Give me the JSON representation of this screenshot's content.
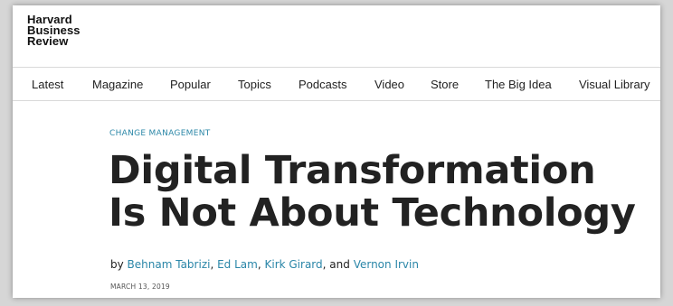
{
  "logo": {
    "line1": "Harvard",
    "line2": "Business",
    "line3": "Review"
  },
  "nav": {
    "items": [
      "Latest",
      "Magazine",
      "Popular",
      "Topics",
      "Podcasts",
      "Video",
      "Store",
      "The Big Idea",
      "Visual Library"
    ]
  },
  "article": {
    "category": "CHANGE MANAGEMENT",
    "headline_line1": "Digital Transformation",
    "headline_line2": "Is Not About Technology",
    "byline": {
      "prefix": "by ",
      "authors": [
        "Behnam Tabrizi",
        "Ed Lam",
        "Kirk Girard",
        "Vernon Irvin"
      ],
      "sep1": ", ",
      "sep2": ", ",
      "sep3": ", and "
    },
    "date": "MARCH 13, 2019"
  },
  "colors": {
    "link": "#2a86a8",
    "category": "#2d88a8",
    "text": "#222222"
  }
}
